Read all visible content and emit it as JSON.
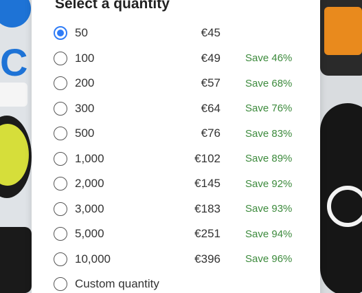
{
  "dialog": {
    "title": "Select a quantity"
  },
  "options": [
    {
      "quantity": "50",
      "price": "€45",
      "save": "",
      "selected": true
    },
    {
      "quantity": "100",
      "price": "€49",
      "save": "Save 46%",
      "selected": false
    },
    {
      "quantity": "200",
      "price": "€57",
      "save": "Save 68%",
      "selected": false
    },
    {
      "quantity": "300",
      "price": "€64",
      "save": "Save 76%",
      "selected": false
    },
    {
      "quantity": "500",
      "price": "€76",
      "save": "Save 83%",
      "selected": false
    },
    {
      "quantity": "1,000",
      "price": "€102",
      "save": "Save 89%",
      "selected": false
    },
    {
      "quantity": "2,000",
      "price": "€145",
      "save": "Save 92%",
      "selected": false
    },
    {
      "quantity": "3,000",
      "price": "€183",
      "save": "Save 93%",
      "selected": false
    },
    {
      "quantity": "5,000",
      "price": "€251",
      "save": "Save 94%",
      "selected": false
    },
    {
      "quantity": "10,000",
      "price": "€396",
      "save": "Save 96%",
      "selected": false
    },
    {
      "quantity": "Custom quantity",
      "price": "",
      "save": "",
      "selected": false
    }
  ],
  "colors": {
    "accent": "#2f7cf6",
    "save_text": "#3c8a3c"
  }
}
